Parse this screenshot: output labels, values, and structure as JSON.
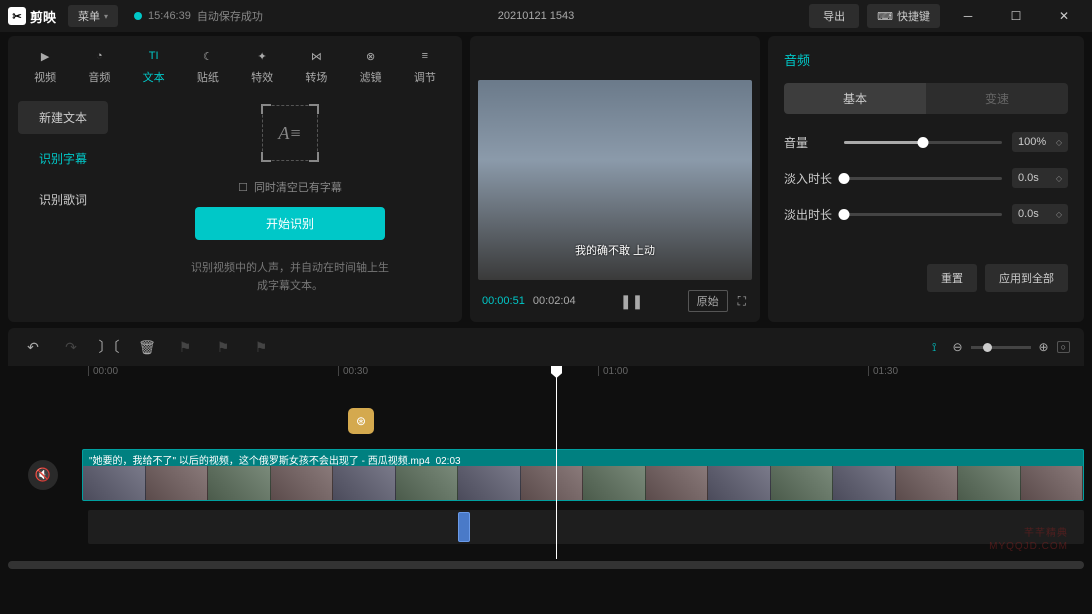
{
  "titlebar": {
    "app_name": "剪映",
    "menu": "菜单",
    "save_time": "15:46:39",
    "save_status": "自动保存成功",
    "project_name": "20210121 1543",
    "export": "导出",
    "shortcuts": "快捷键"
  },
  "media_tabs": [
    {
      "label": "视频",
      "icon": "▶"
    },
    {
      "label": "音频",
      "icon": "◔"
    },
    {
      "label": "文本",
      "icon": "TI",
      "active": true
    },
    {
      "label": "贴纸",
      "icon": "☾"
    },
    {
      "label": "特效",
      "icon": "✦"
    },
    {
      "label": "转场",
      "icon": "⋈"
    },
    {
      "label": "滤镜",
      "icon": "⊗"
    },
    {
      "label": "调节",
      "icon": "≡"
    }
  ],
  "text_sidebar": {
    "new_text": "新建文本",
    "recog_sub": "识别字幕",
    "recog_lyric": "识别歌词"
  },
  "recognize": {
    "checkbox": "同时清空已有字幕",
    "start": "开始识别",
    "description": "识别视频中的人声，并自动在时间轴上生成字幕文本。"
  },
  "preview": {
    "subtitle": "我的确不敢 上动",
    "current": "00:00:51",
    "duration": "00:02:04",
    "original": "原始"
  },
  "audio_panel": {
    "title": "音频",
    "tab_basic": "基本",
    "tab_speed": "变速",
    "volume_label": "音量",
    "volume_value": "100%",
    "fadein_label": "淡入时长",
    "fadein_value": "0.0s",
    "fadeout_label": "淡出时长",
    "fadeout_value": "0.0s",
    "reset": "重置",
    "apply_all": "应用到全部"
  },
  "ruler": {
    "m0": "00:00",
    "m1": "00:30",
    "m2": "01:00",
    "m3": "01:30"
  },
  "clip": {
    "title": "\"她要的，我给不了\" 以后的视频，这个俄罗斯女孩不会出现了 - 西瓜视频.mp4",
    "dur": "02:03"
  },
  "watermark": {
    "line1": "芊芊精典",
    "line2": "MYQQJD.COM"
  }
}
